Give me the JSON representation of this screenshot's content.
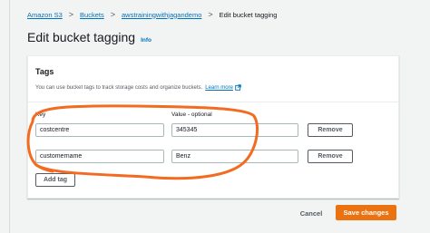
{
  "breadcrumb": {
    "items": [
      "Amazon S3",
      "Buckets",
      "awstrainingwithjagandemo"
    ],
    "current": "Edit bucket tagging",
    "separator": ">"
  },
  "page": {
    "title": "Edit bucket tagging",
    "info_label": "Info"
  },
  "tags_panel": {
    "title": "Tags",
    "description": "You can use bucket tags to track storage costs and organize buckets.",
    "learn_more_label": "Learn more",
    "key_label": "Key",
    "value_label": "Value - optional",
    "rows": [
      {
        "key": "costcentre",
        "value": "345345",
        "remove_label": "Remove"
      },
      {
        "key": "customername",
        "value": "Benz",
        "remove_label": "Remove"
      }
    ],
    "add_tag_label": "Add tag"
  },
  "footer": {
    "cancel_label": "Cancel",
    "save_label": "Save changes"
  },
  "colors": {
    "link": "#0073bb",
    "primary_button": "#ec7211",
    "annotation_stroke": "#f26b21",
    "page_background": "#f2f3f3"
  }
}
